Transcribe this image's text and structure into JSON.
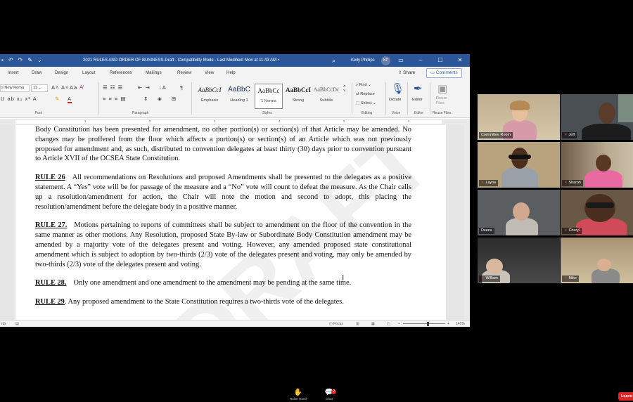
{
  "word": {
    "title": "2021 RULES AND ORDER OF BUSINESS-Draft  -  Compatibility Mode  -  Last Modified: Mon at 11:43 AM  •",
    "user": "Kelly Phillips",
    "user_initials": "KP",
    "tabs": [
      "Insert",
      "Draw",
      "Design",
      "Layout",
      "References",
      "Mailings",
      "Review",
      "View",
      "Help"
    ],
    "share_label": "Share",
    "comments_label": "Comments",
    "font_name": "s New Roma",
    "font_size": "11",
    "group_labels": {
      "font": "Font",
      "paragraph": "Paragraph",
      "styles": "Styles",
      "editing": "Editing",
      "voice": "Voice",
      "editor": "Editor",
      "reuse": "Reuse Files"
    },
    "styles": [
      {
        "sample": "AaBbCcI",
        "name": "Emphasis"
      },
      {
        "sample": "AaBbC",
        "name": "Heading 1"
      },
      {
        "sample": "AaBbCc",
        "name": "1 Norma"
      },
      {
        "sample": "AaBbCcI",
        "name": "Strong"
      },
      {
        "sample": "AaBbCcDc",
        "name": "Subtitle"
      }
    ],
    "editing": {
      "find": "Find",
      "replace": "Replace",
      "select": "Select"
    },
    "dictate_label": "Dictate",
    "editor_label": "Editor",
    "reuse_label": "Reuse\nFiles",
    "ruler_numbers": [
      "1",
      "2",
      "3",
      "4",
      "5",
      "6"
    ],
    "status": {
      "left": "rds",
      "focus": "Focus",
      "zoom": "141%"
    }
  },
  "document": {
    "p1": "Body Constitution has been presented for amendment, no other portion(s) or section(s) of that Article may be amended. No changes may be proffered from the floor which affects a portion(s) or section(s) of an Article which was not previously proposed for amendment and, as such, distributed to convention delegates at least thirty (30) days prior to convention pursuant to Article XVII of the OCSEA State Constitution.",
    "rule26_head": "RULE 26",
    "rule26": "All recommendations on Resolutions and proposed Amendments shall be presented to the delegates as a positive statement. A “Yes” vote will be for passage of the measure and a “No” vote will count to defeat the measure. As the Chair calls up a resolution/amendment for action, the Chair will note the motion and second to adopt, this placing the resolution/amendment before the delegate body in a positive manner.",
    "rule27_head": "RULE 27.",
    "rule27": "Motions pertaining to reports of committees shall be subject to amendment on the floor of the convention in the same manner as other motions. Any Resolution, proposed State By-law or Subordinate Body Constitution amendment may be amended by a majority vote of the delegates present and voting. However, any amended proposed state constitutional amendment which is subject to adoption by two-thirds (2/3) vote of the delegates present and voting, may only be amended by two-thirds (2/3) vote of the delegates present and voting.",
    "rule28_head": "RULE 28.",
    "rule28": "Only one amendment and one amendment to the amendment may be pending at the same time.",
    "rule29_head": "RULE 29",
    "rule29": ". Any proposed amendment to the State Constitution requires a two-thirds vote of the delegates.",
    "watermark": "DRAFT"
  },
  "participants": [
    {
      "name": "Committee Room"
    },
    {
      "name": "Jeff"
    },
    {
      "name": "Layne"
    },
    {
      "name": "Sharon"
    },
    {
      "name": "Deena"
    },
    {
      "name": "Cheryl"
    },
    {
      "name": "William"
    },
    {
      "name": "Mike"
    }
  ],
  "controls": {
    "raise_hand": "Raise Hand",
    "chat": "Chat",
    "chat_badge": "2",
    "leave": "Leave"
  },
  "colors": {
    "word_blue": "#2b579a",
    "active_speaker": "#d6e000",
    "leave_red": "#e02525"
  }
}
